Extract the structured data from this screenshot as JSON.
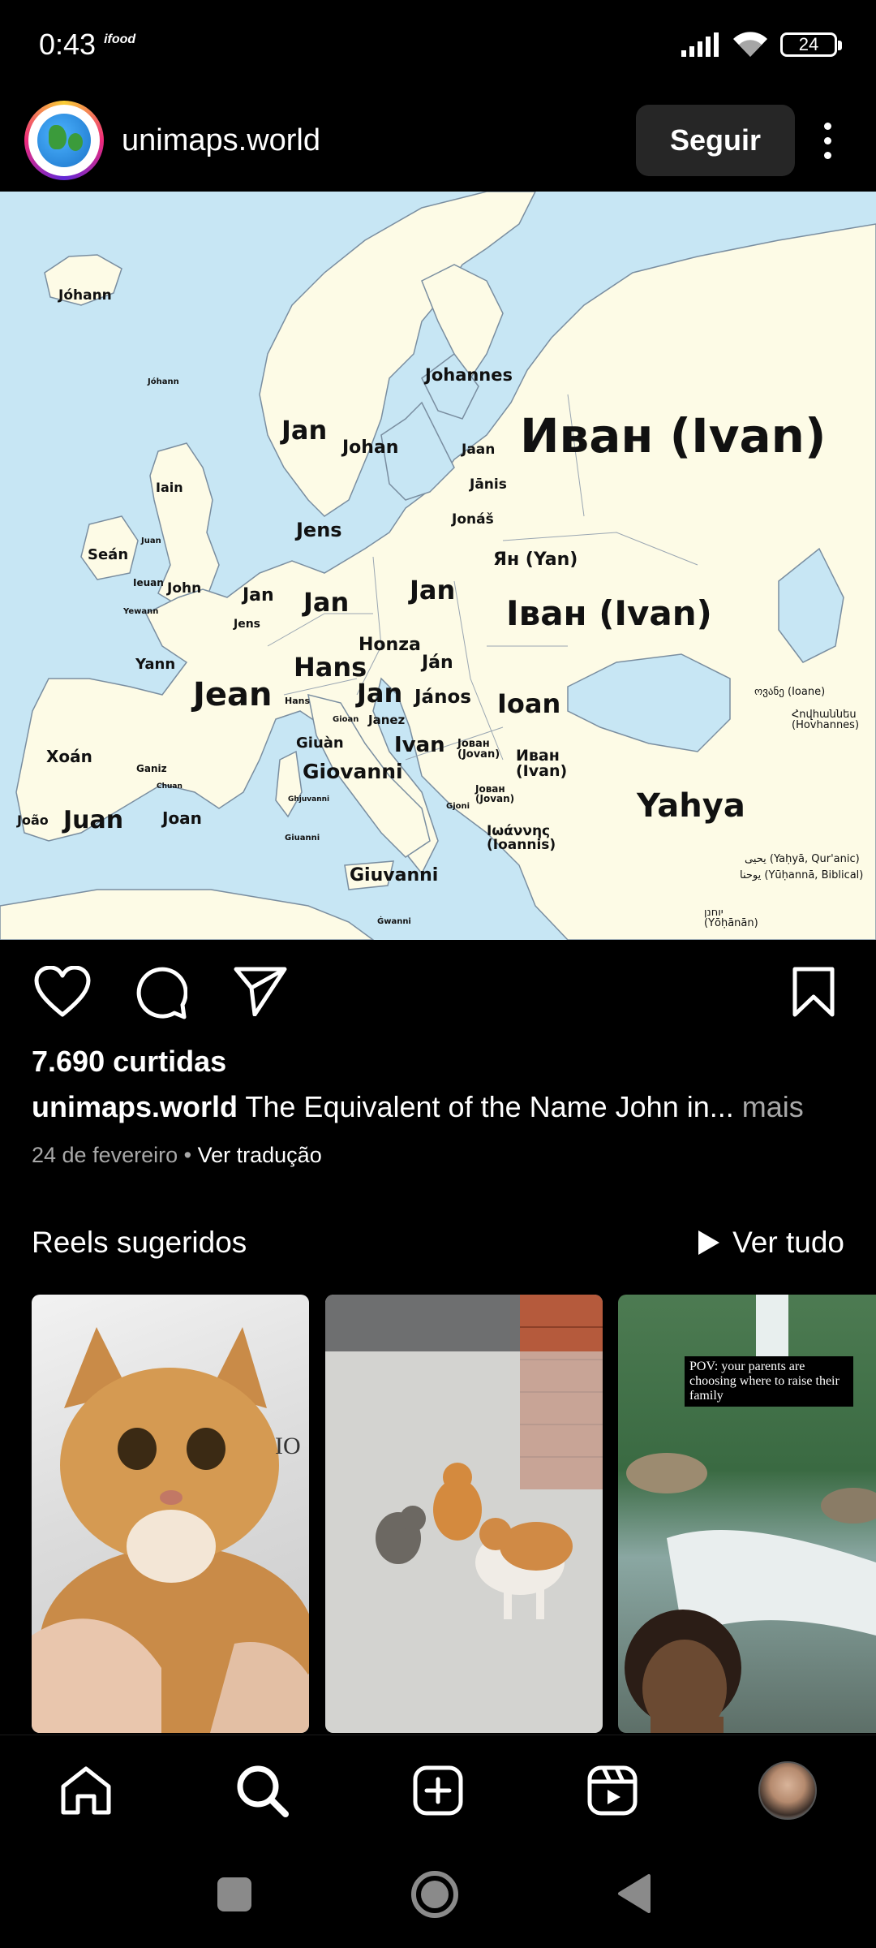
{
  "status_bar": {
    "time": "0:43",
    "app_notification": "ifood",
    "battery": "24",
    "icons": [
      "signal-icon",
      "wifi-icon",
      "battery-icon"
    ]
  },
  "post": {
    "username": "unimaps.world",
    "follow_label": "Seguir",
    "avatar_icon": "globe-logo",
    "image": {
      "type": "map",
      "labels": [
        {
          "text": "Jóhann",
          "size": "s"
        },
        {
          "text": "Jóhann",
          "size": "xs"
        },
        {
          "text": "Johannes",
          "size": "m"
        },
        {
          "text": "Иван (Ivan)",
          "size": "xl"
        },
        {
          "text": "Jan",
          "size": "l"
        },
        {
          "text": "Johan",
          "size": "m"
        },
        {
          "text": "Jaan",
          "size": "s"
        },
        {
          "text": "Jānis",
          "size": "s"
        },
        {
          "text": "Iain",
          "size": "s"
        },
        {
          "text": "Jonáš",
          "size": "s"
        },
        {
          "text": "Jens",
          "size": "m"
        },
        {
          "text": "Seán",
          "size": "m"
        },
        {
          "text": "Juan",
          "size": "xs"
        },
        {
          "text": "Ян (Yan)",
          "size": "m"
        },
        {
          "text": "Jan",
          "size": "l"
        },
        {
          "text": "Ieuan",
          "size": "xs"
        },
        {
          "text": "John",
          "size": "s"
        },
        {
          "text": "Jan",
          "size": "m"
        },
        {
          "text": "Jan",
          "size": "l"
        },
        {
          "text": "Іван (Ivan)",
          "size": "xl"
        },
        {
          "text": "Yewann",
          "size": "xs"
        },
        {
          "text": "Jens",
          "size": "xs"
        },
        {
          "text": "Honza",
          "size": "m"
        },
        {
          "text": "Yann",
          "size": "s"
        },
        {
          "text": "Hans",
          "size": "l"
        },
        {
          "text": "Ján",
          "size": "m"
        },
        {
          "text": "Jean",
          "size": "xl"
        },
        {
          "text": "Jan",
          "size": "l"
        },
        {
          "text": "János",
          "size": "m"
        },
        {
          "text": "Ioan",
          "size": "l"
        },
        {
          "text": "Hans",
          "size": "xs"
        },
        {
          "text": "Gioan",
          "size": "xs"
        },
        {
          "text": "Janez",
          "size": "xs"
        },
        {
          "text": "ოვანე (Ioane)",
          "size": "xs"
        },
        {
          "text": "Giuàn",
          "size": "s"
        },
        {
          "text": "Ivan",
          "size": "m"
        },
        {
          "text": "Јован (Jovan)",
          "size": "xs"
        },
        {
          "text": "Հովհաննես (Hovhannes)",
          "size": "xs"
        },
        {
          "text": "Xoán",
          "size": "m"
        },
        {
          "text": "Ganiz",
          "size": "xs"
        },
        {
          "text": "Giovanni",
          "size": "m"
        },
        {
          "text": "Иван (Ivan)",
          "size": "m"
        },
        {
          "text": "Chuan",
          "size": "xs"
        },
        {
          "text": "Ghjuvanni",
          "size": "xs"
        },
        {
          "text": "Јован (Jovan)",
          "size": "xs"
        },
        {
          "text": "Gjoni",
          "size": "xs"
        },
        {
          "text": "João",
          "size": "s"
        },
        {
          "text": "Juan",
          "size": "l"
        },
        {
          "text": "Joan",
          "size": "m"
        },
        {
          "text": "Yahya",
          "size": "xl"
        },
        {
          "text": "Iωάννης (Ioannis)",
          "size": "s"
        },
        {
          "text": "Giuanni",
          "size": "xs"
        },
        {
          "text": "يحيى (Yaḥyā, Qur'anic)",
          "size": "xs"
        },
        {
          "text": "يوحنا (Yūḥannā, Biblical)",
          "size": "xs"
        },
        {
          "text": "Giuvanni",
          "size": "m"
        },
        {
          "text": "Ġwanni",
          "size": "xs"
        },
        {
          "text": "יוחנן (Yōḥānān)",
          "size": "xs"
        }
      ]
    },
    "likes": "7.690 curtidas",
    "caption_username": "unimaps.world",
    "caption_text": "The Equivalent of the Name John in...",
    "caption_more": "mais",
    "date": "24 de fevereiro",
    "separator": "•",
    "translate_label": "Ver tradução"
  },
  "reels": {
    "title": "Reels sugeridos",
    "see_all": "Ver tudo",
    "items": [
      {
        "description": "orange cat held in hands",
        "overlay": "IO"
      },
      {
        "description": "three cats in a courtyard",
        "overlay": ""
      },
      {
        "description": "waterfall river with person",
        "overlay": "POV: your parents are choosing where to raise their family"
      }
    ]
  },
  "bottom_nav": [
    "home-icon",
    "search-icon",
    "create-icon",
    "reels-icon",
    "profile-avatar"
  ],
  "system_nav": [
    "recents-button",
    "home-button",
    "back-button"
  ]
}
